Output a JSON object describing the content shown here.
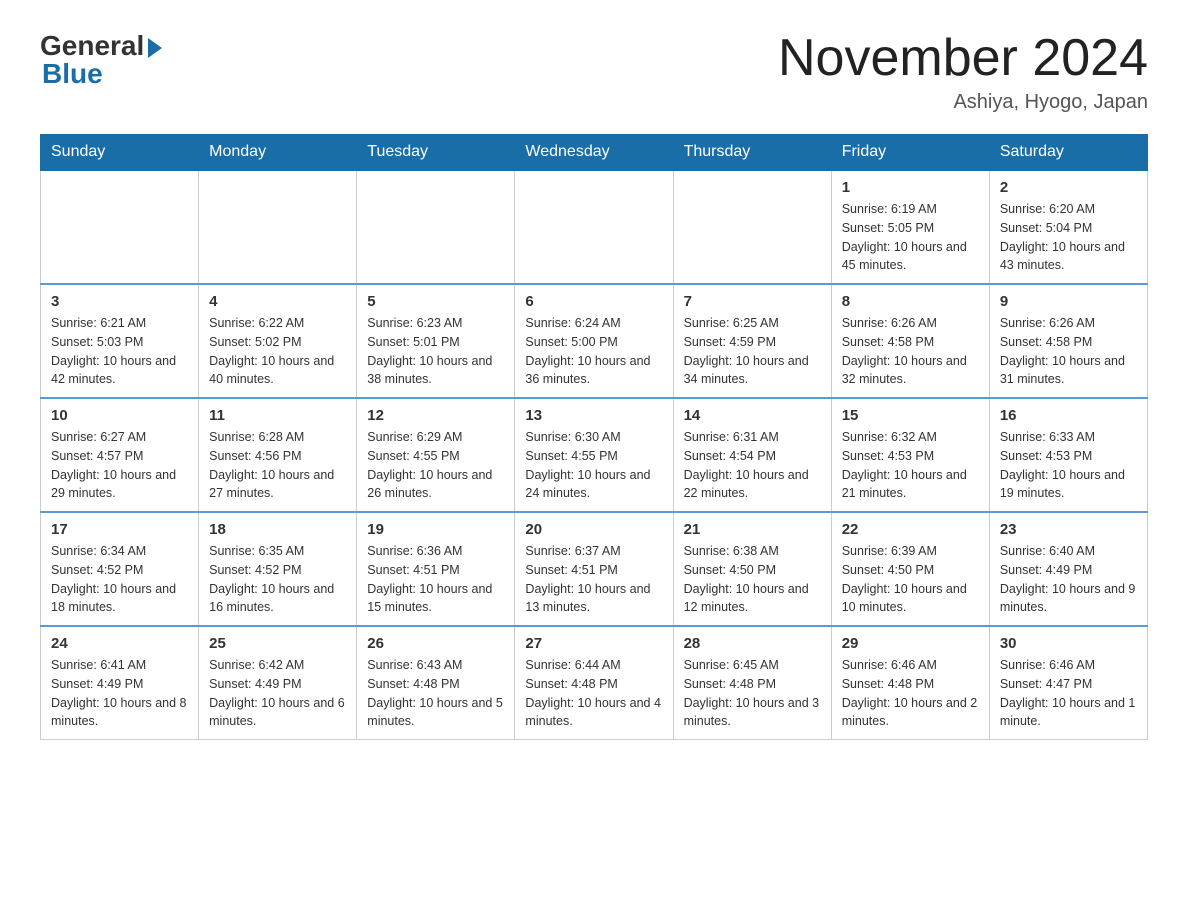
{
  "header": {
    "logo_general": "General",
    "logo_blue": "Blue",
    "month_title": "November 2024",
    "location": "Ashiya, Hyogo, Japan"
  },
  "weekdays": [
    "Sunday",
    "Monday",
    "Tuesday",
    "Wednesday",
    "Thursday",
    "Friday",
    "Saturday"
  ],
  "weeks": [
    [
      {
        "day": "",
        "info": ""
      },
      {
        "day": "",
        "info": ""
      },
      {
        "day": "",
        "info": ""
      },
      {
        "day": "",
        "info": ""
      },
      {
        "day": "",
        "info": ""
      },
      {
        "day": "1",
        "info": "Sunrise: 6:19 AM\nSunset: 5:05 PM\nDaylight: 10 hours and 45 minutes."
      },
      {
        "day": "2",
        "info": "Sunrise: 6:20 AM\nSunset: 5:04 PM\nDaylight: 10 hours and 43 minutes."
      }
    ],
    [
      {
        "day": "3",
        "info": "Sunrise: 6:21 AM\nSunset: 5:03 PM\nDaylight: 10 hours and 42 minutes."
      },
      {
        "day": "4",
        "info": "Sunrise: 6:22 AM\nSunset: 5:02 PM\nDaylight: 10 hours and 40 minutes."
      },
      {
        "day": "5",
        "info": "Sunrise: 6:23 AM\nSunset: 5:01 PM\nDaylight: 10 hours and 38 minutes."
      },
      {
        "day": "6",
        "info": "Sunrise: 6:24 AM\nSunset: 5:00 PM\nDaylight: 10 hours and 36 minutes."
      },
      {
        "day": "7",
        "info": "Sunrise: 6:25 AM\nSunset: 4:59 PM\nDaylight: 10 hours and 34 minutes."
      },
      {
        "day": "8",
        "info": "Sunrise: 6:26 AM\nSunset: 4:58 PM\nDaylight: 10 hours and 32 minutes."
      },
      {
        "day": "9",
        "info": "Sunrise: 6:26 AM\nSunset: 4:58 PM\nDaylight: 10 hours and 31 minutes."
      }
    ],
    [
      {
        "day": "10",
        "info": "Sunrise: 6:27 AM\nSunset: 4:57 PM\nDaylight: 10 hours and 29 minutes."
      },
      {
        "day": "11",
        "info": "Sunrise: 6:28 AM\nSunset: 4:56 PM\nDaylight: 10 hours and 27 minutes."
      },
      {
        "day": "12",
        "info": "Sunrise: 6:29 AM\nSunset: 4:55 PM\nDaylight: 10 hours and 26 minutes."
      },
      {
        "day": "13",
        "info": "Sunrise: 6:30 AM\nSunset: 4:55 PM\nDaylight: 10 hours and 24 minutes."
      },
      {
        "day": "14",
        "info": "Sunrise: 6:31 AM\nSunset: 4:54 PM\nDaylight: 10 hours and 22 minutes."
      },
      {
        "day": "15",
        "info": "Sunrise: 6:32 AM\nSunset: 4:53 PM\nDaylight: 10 hours and 21 minutes."
      },
      {
        "day": "16",
        "info": "Sunrise: 6:33 AM\nSunset: 4:53 PM\nDaylight: 10 hours and 19 minutes."
      }
    ],
    [
      {
        "day": "17",
        "info": "Sunrise: 6:34 AM\nSunset: 4:52 PM\nDaylight: 10 hours and 18 minutes."
      },
      {
        "day": "18",
        "info": "Sunrise: 6:35 AM\nSunset: 4:52 PM\nDaylight: 10 hours and 16 minutes."
      },
      {
        "day": "19",
        "info": "Sunrise: 6:36 AM\nSunset: 4:51 PM\nDaylight: 10 hours and 15 minutes."
      },
      {
        "day": "20",
        "info": "Sunrise: 6:37 AM\nSunset: 4:51 PM\nDaylight: 10 hours and 13 minutes."
      },
      {
        "day": "21",
        "info": "Sunrise: 6:38 AM\nSunset: 4:50 PM\nDaylight: 10 hours and 12 minutes."
      },
      {
        "day": "22",
        "info": "Sunrise: 6:39 AM\nSunset: 4:50 PM\nDaylight: 10 hours and 10 minutes."
      },
      {
        "day": "23",
        "info": "Sunrise: 6:40 AM\nSunset: 4:49 PM\nDaylight: 10 hours and 9 minutes."
      }
    ],
    [
      {
        "day": "24",
        "info": "Sunrise: 6:41 AM\nSunset: 4:49 PM\nDaylight: 10 hours and 8 minutes."
      },
      {
        "day": "25",
        "info": "Sunrise: 6:42 AM\nSunset: 4:49 PM\nDaylight: 10 hours and 6 minutes."
      },
      {
        "day": "26",
        "info": "Sunrise: 6:43 AM\nSunset: 4:48 PM\nDaylight: 10 hours and 5 minutes."
      },
      {
        "day": "27",
        "info": "Sunrise: 6:44 AM\nSunset: 4:48 PM\nDaylight: 10 hours and 4 minutes."
      },
      {
        "day": "28",
        "info": "Sunrise: 6:45 AM\nSunset: 4:48 PM\nDaylight: 10 hours and 3 minutes."
      },
      {
        "day": "29",
        "info": "Sunrise: 6:46 AM\nSunset: 4:48 PM\nDaylight: 10 hours and 2 minutes."
      },
      {
        "day": "30",
        "info": "Sunrise: 6:46 AM\nSunset: 4:47 PM\nDaylight: 10 hours and 1 minute."
      }
    ]
  ]
}
